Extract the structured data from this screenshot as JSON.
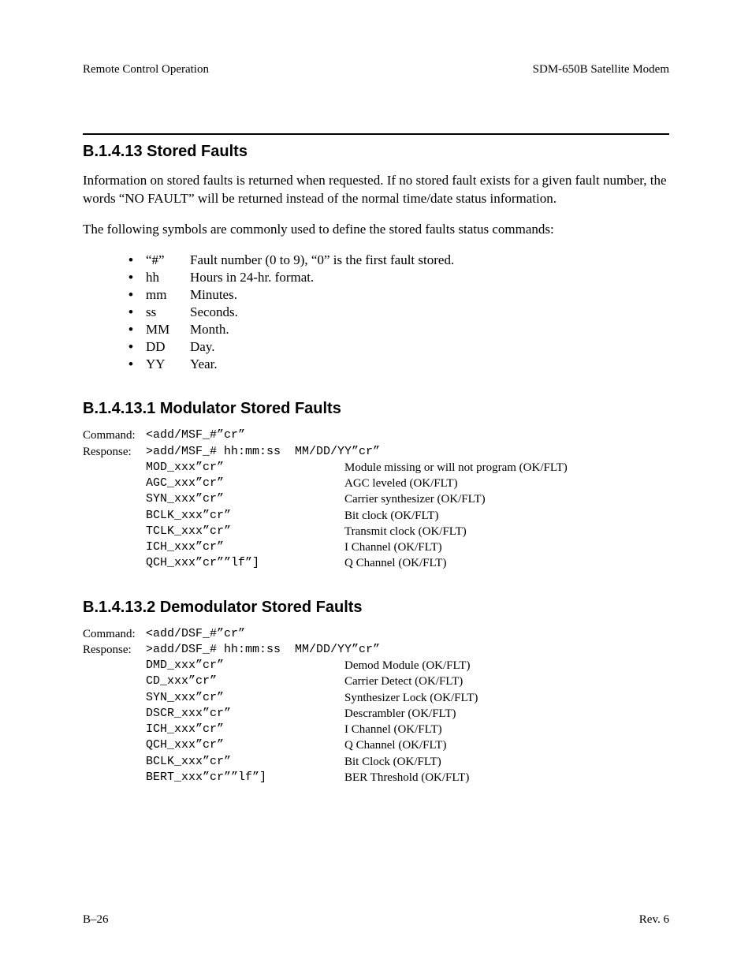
{
  "header": {
    "left": "Remote Control Operation",
    "right": "SDM-650B Satellite Modem"
  },
  "section": {
    "num_title": "B.1.4.13  Stored Faults",
    "para1": "Information on stored faults is returned when requested. If no stored fault exists for a given fault number, the words “NO FAULT” will be returned instead of the normal time/date status information.",
    "para2": "The following symbols are commonly used to define the stored faults status commands:",
    "symbols": [
      {
        "sym": "“#”",
        "desc": "Fault number (0 to 9), “0” is the first fault stored."
      },
      {
        "sym": "hh",
        "desc": "Hours in 24-hr. format."
      },
      {
        "sym": "mm",
        "desc": "Minutes."
      },
      {
        "sym": "ss",
        "desc": "Seconds."
      },
      {
        "sym": "MM",
        "desc": "Month."
      },
      {
        "sym": "DD",
        "desc": "Day."
      },
      {
        "sym": "YY",
        "desc": "Year."
      }
    ]
  },
  "sub1": {
    "title": "B.1.4.13.1  Modulator Stored Faults",
    "cmd_label": "Command:",
    "resp_label": "Response:",
    "cmd_code": "<add/MSF_#”cr”",
    "resp_code": ">add/MSF_# hh:mm:ss  MM/DD/YY”cr”",
    "rows": [
      {
        "code": "MOD_xxx”cr”",
        "desc": "Module missing or will not program (OK/FLT)"
      },
      {
        "code": "AGC_xxx”cr”",
        "desc": "AGC leveled (OK/FLT)"
      },
      {
        "code": "SYN_xxx”cr”",
        "desc": "Carrier synthesizer (OK/FLT)"
      },
      {
        "code": "BCLK_xxx”cr”",
        "desc": "Bit clock (OK/FLT)"
      },
      {
        "code": "TCLK_xxx”cr”",
        "desc": "Transmit clock (OK/FLT)"
      },
      {
        "code": "ICH_xxx”cr”",
        "desc": "I Channel (OK/FLT)"
      },
      {
        "code": "QCH_xxx”cr””lf”]",
        "desc": "Q Channel (OK/FLT)"
      }
    ]
  },
  "sub2": {
    "title": "B.1.4.13.2  Demodulator Stored Faults",
    "cmd_label": "Command:",
    "resp_label": "Response:",
    "cmd_code": "<add/DSF_#”cr”",
    "resp_code": ">add/DSF_# hh:mm:ss  MM/DD/YY”cr”",
    "rows": [
      {
        "code": "DMD_xxx”cr”",
        "desc": "Demod Module (OK/FLT)"
      },
      {
        "code": "CD_xxx”cr”",
        "desc": "Carrier Detect (OK/FLT)"
      },
      {
        "code": "SYN_xxx”cr”",
        "desc": "Synthesizer Lock (OK/FLT)"
      },
      {
        "code": "DSCR_xxx”cr”",
        "desc": "Descrambler (OK/FLT)"
      },
      {
        "code": "ICH_xxx”cr”",
        "desc": "I Channel (OK/FLT)"
      },
      {
        "code": "QCH_xxx”cr”",
        "desc": "Q Channel (OK/FLT)"
      },
      {
        "code": "BCLK_xxx”cr”",
        "desc": "Bit Clock (OK/FLT)"
      },
      {
        "code": "BERT_xxx”cr””lf”]",
        "desc": "BER Threshold (OK/FLT)"
      }
    ]
  },
  "footer": {
    "left": "B–26",
    "right": "Rev. 6"
  }
}
